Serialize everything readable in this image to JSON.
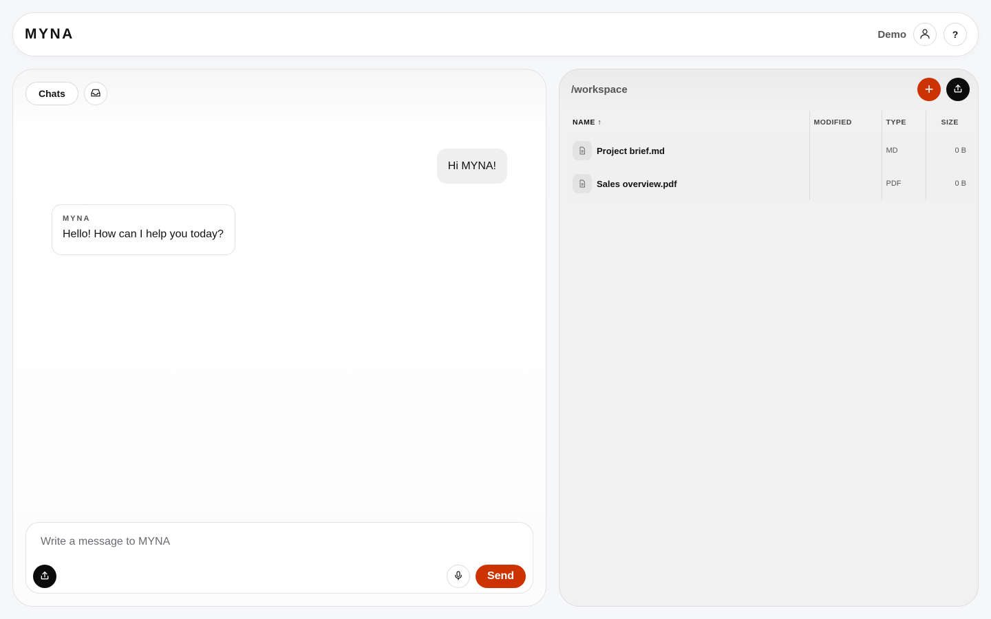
{
  "header": {
    "brand": "MYNA",
    "user_name": "Demo",
    "user_icon": "user-icon",
    "help_label": "?"
  },
  "chat": {
    "tabs_label": "Chats",
    "inbox_icon": "inbox-icon",
    "messages": [
      {
        "role": "user",
        "text": "Hi MYNA!"
      },
      {
        "role": "assistant",
        "sender": "MYNA",
        "text": "Hello! How can I help you today?"
      }
    ],
    "composer": {
      "placeholder": "Write a message to MYNA",
      "value": "",
      "upload_icon": "upload-icon",
      "mic_icon": "microphone-icon",
      "send_label": "Send"
    }
  },
  "files": {
    "path": "/workspace",
    "add_label": "+",
    "upload_icon": "upload-icon",
    "columns": {
      "name": "NAME",
      "sort_indicator": "↑",
      "modified": "MODIFIED",
      "type": "TYPE",
      "size": "SIZE"
    },
    "rows": [
      {
        "name": "Project brief.md",
        "modified": "",
        "type": "MD",
        "size": "0 B",
        "icon": "document-icon"
      },
      {
        "name": "Sales overview.pdf",
        "modified": "",
        "type": "PDF",
        "size": "0 B",
        "icon": "document-icon"
      }
    ]
  },
  "colors": {
    "accent": "#cc3300",
    "dark_button": "#0b0b0b",
    "panel_bg": "#f1f1f1"
  }
}
